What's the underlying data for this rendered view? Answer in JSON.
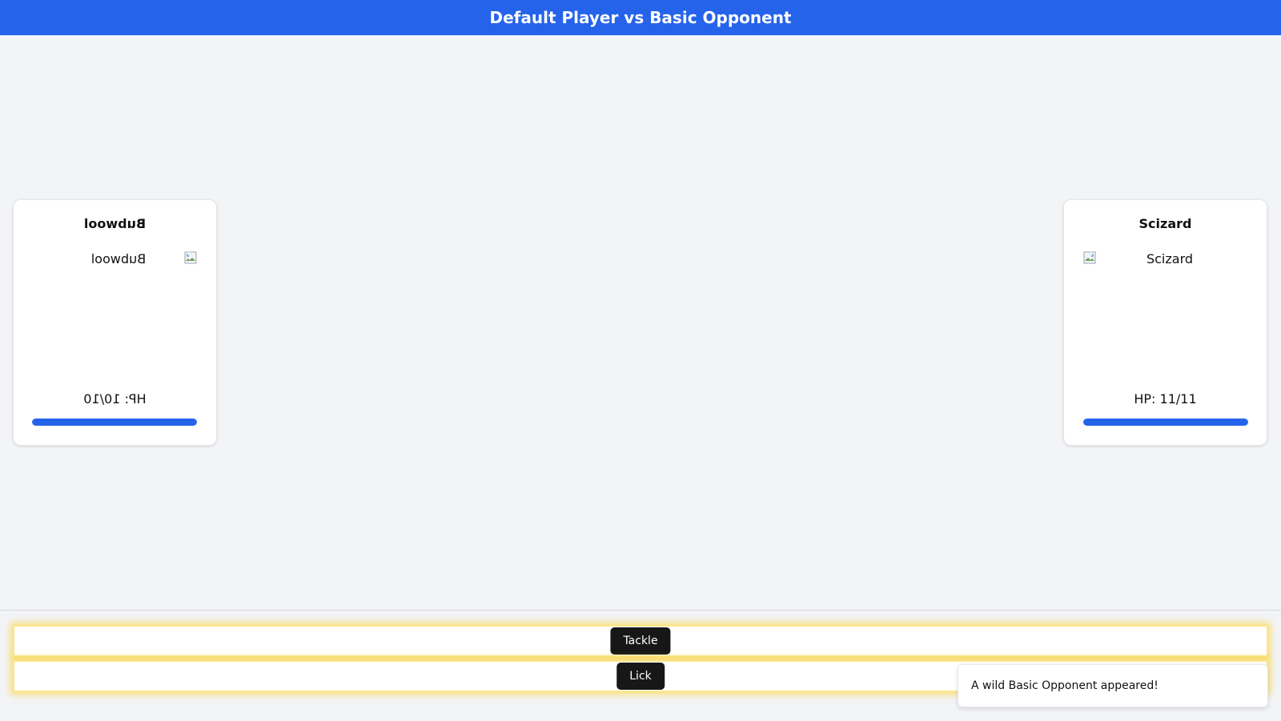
{
  "header": {
    "title": "Default Player vs Basic Opponent",
    "color": "#2563eb"
  },
  "player": {
    "name": "Bubwool",
    "sprite_alt": "Bubwool",
    "hp_text": "HP: 10/10",
    "hp_current": 10,
    "hp_max": 10,
    "mirrored": true
  },
  "opponent": {
    "name": "Scizard",
    "sprite_alt": "Scizard",
    "hp_text": "HP: 11/11",
    "hp_current": 11,
    "hp_max": 11
  },
  "moves": [
    {
      "label": "Tackle"
    },
    {
      "label": "Lick"
    }
  ],
  "toast": {
    "message": "A wild Basic Opponent appeared!"
  },
  "colors": {
    "accent": "#2563eb",
    "hp_bar": "#2563eb",
    "move_button": "#171717",
    "move_highlight": "#facc15"
  },
  "icons": {
    "sprite_placeholder": "broken-image-icon"
  }
}
